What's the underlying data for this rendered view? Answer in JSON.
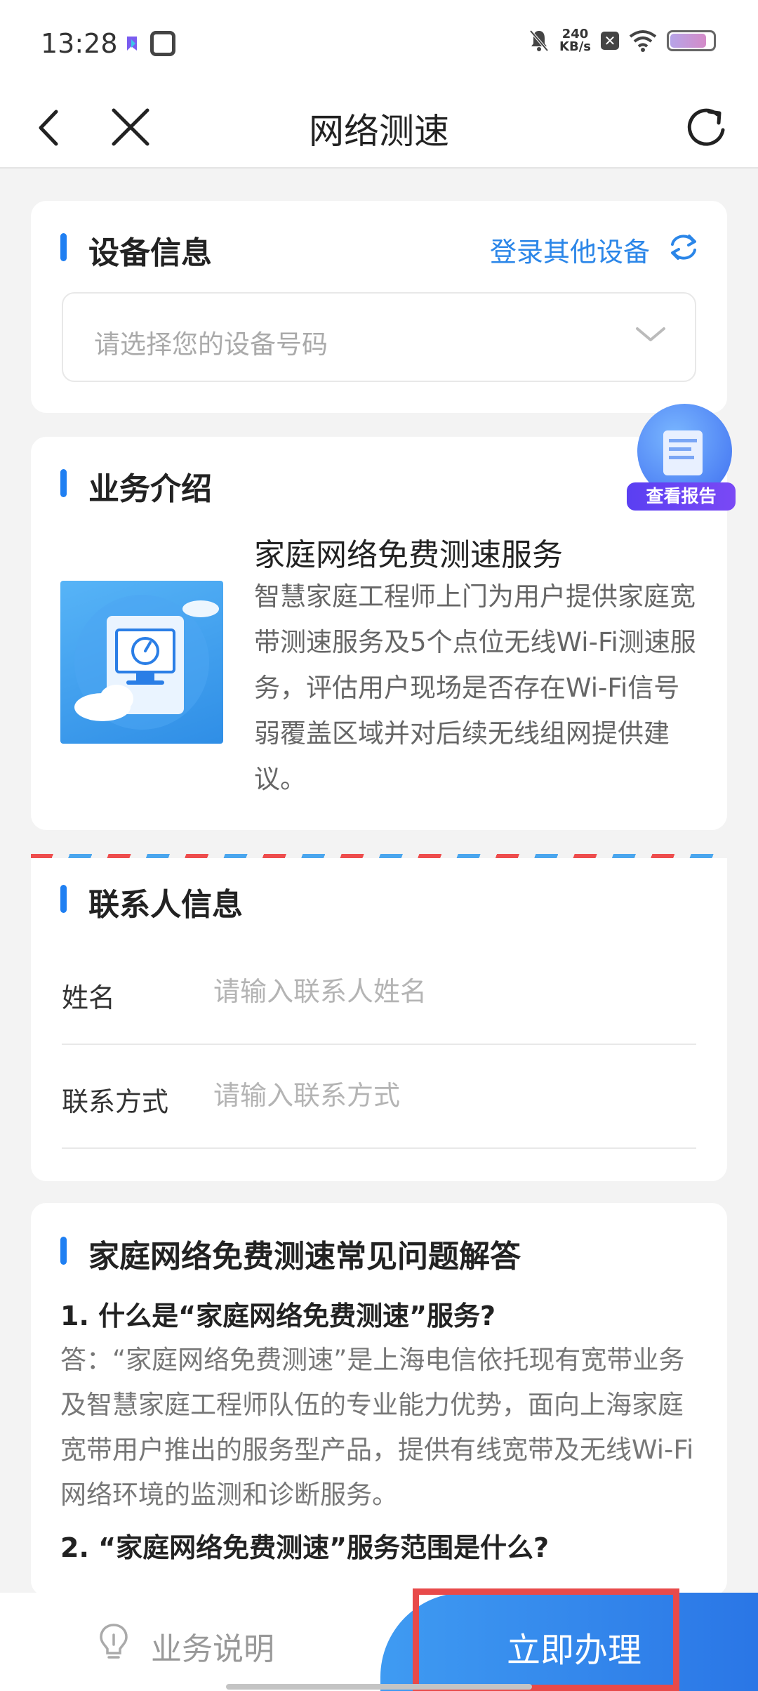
{
  "status": {
    "time": "13:28",
    "net_speed_value": "240",
    "net_speed_unit": "KB/s",
    "battery_level": 0.85,
    "icons": [
      "app-icon",
      "message-box-icon",
      "mute-bell-icon",
      "close-box-icon",
      "wifi-icon",
      "battery-icon"
    ]
  },
  "nav": {
    "title": "网络测速",
    "icons": [
      "back-icon",
      "close-icon",
      "refresh-icon"
    ]
  },
  "device_section": {
    "title": "设备信息",
    "login_other": "登录其他设备",
    "select_placeholder": "请选择您的设备号码"
  },
  "report_badge": {
    "label": "查看报告"
  },
  "intro_section": {
    "title": "业务介绍",
    "service_title": "家庭网络免费测速服务",
    "service_desc": "智慧家庭工程师上门为用户提供家庭宽带测速服务及5个点位无线Wi-Fi测速服务，评估用户现场是否存在Wi-Fi信号弱覆盖区域并对后续无线组网提供建议。"
  },
  "contact_section": {
    "title": "联系人信息",
    "name_label": "姓名",
    "name_placeholder": "请输入联系人姓名",
    "phone_label": "联系方式",
    "phone_placeholder": "请输入联系方式"
  },
  "faq_section": {
    "title": "家庭网络免费测速常见问题解答",
    "items": [
      {
        "q": "1. 什么是“家庭网络免费测速”服务?",
        "a": "答：“家庭网络免费测速”是上海电信依托现有宽带业务及智慧家庭工程师队伍的专业能力优势，面向上海家庭宽带用户推出的服务型产品，提供有线宽带及无线Wi-Fi网络环境的监测和诊断服务。"
      },
      {
        "q": "2. “家庭网络免费测速”服务范围是什么?",
        "a": ""
      }
    ]
  },
  "bottom": {
    "biz_note": "业务说明",
    "apply": "立即办理"
  },
  "colors": {
    "accent": "#1f7ff2",
    "link": "#2b86e8",
    "highlight": "#e84a4a",
    "badge": "#5a3ff2"
  }
}
